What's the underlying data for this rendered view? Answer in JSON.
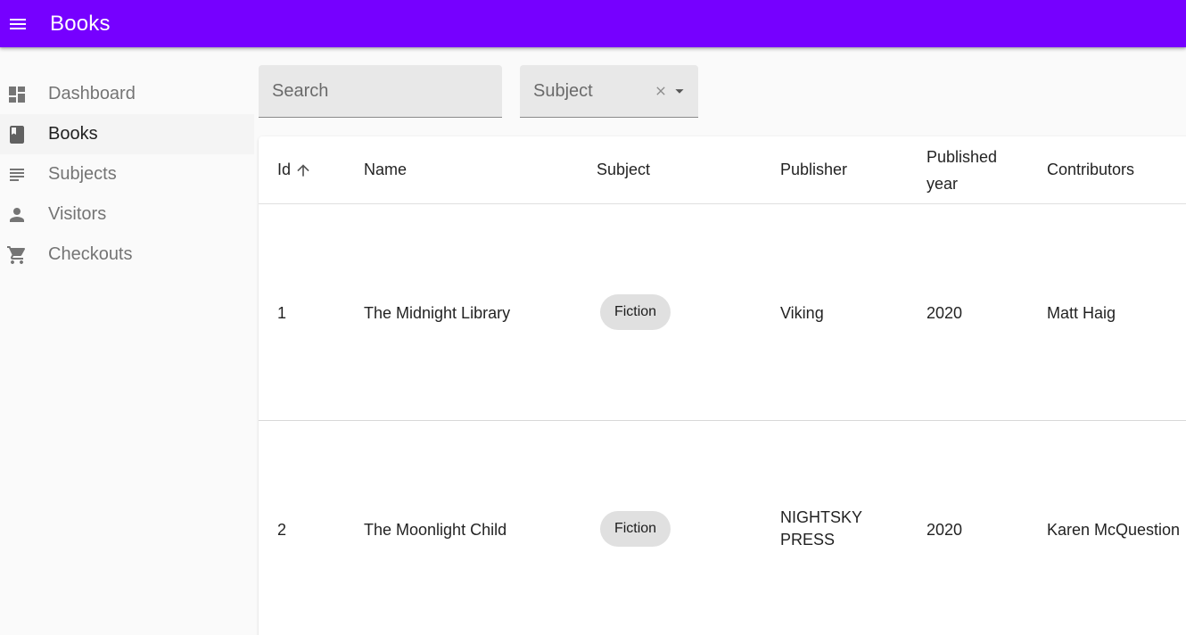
{
  "appbar": {
    "title": "Books",
    "menu_icon": "menu-icon",
    "color": "#7600ff"
  },
  "sidebar": {
    "items": [
      {
        "label": "Dashboard",
        "icon": "dashboard-icon",
        "active": false
      },
      {
        "label": "Books",
        "icon": "book-icon",
        "active": true
      },
      {
        "label": "Subjects",
        "icon": "subject-lines-icon",
        "active": false
      },
      {
        "label": "Visitors",
        "icon": "person-icon",
        "active": false
      },
      {
        "label": "Checkouts",
        "icon": "cart-icon",
        "active": false
      }
    ]
  },
  "filters": {
    "search": {
      "placeholder": "Search",
      "value": ""
    },
    "subject": {
      "label": "Subject",
      "value": ""
    }
  },
  "table": {
    "columns": [
      "Id",
      "Name",
      "Subject",
      "Publisher",
      "Published year",
      "Contributors"
    ],
    "column_year_lines": [
      "Published",
      "year"
    ],
    "sort": {
      "column": "Id",
      "direction": "asc"
    },
    "rows": [
      {
        "id": "1",
        "name": "The Midnight Library",
        "subject": "Fiction",
        "publisher": "Viking",
        "year": "2020",
        "contributors": "Matt Haig"
      },
      {
        "id": "2",
        "name": "The Moonlight Child",
        "subject": "Fiction",
        "publisher": "NIGHTSKY PRESS",
        "publisher_lines": [
          "NIGHTSKY",
          "PRESS"
        ],
        "year": "2020",
        "contributors": "Karen McQuestion"
      }
    ]
  }
}
